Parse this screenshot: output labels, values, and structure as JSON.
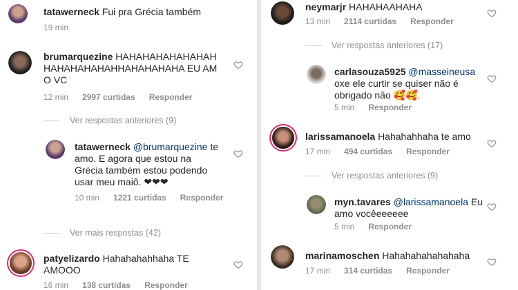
{
  "left": {
    "c1": {
      "user": "tatawerneck",
      "text": "Fui pra Grécia também",
      "time": "19 min"
    },
    "c2": {
      "user": "brumarquezine",
      "text": "HAHAHAHAHAHAHAH HAHAHAHAHAHHAHAHAHAHA EU AMO VC",
      "time": "12 min",
      "likes": "2997 curtidas",
      "reply": "Responder"
    },
    "view_prev": "Ver respostas anteriores (9)",
    "c3": {
      "user": "tatawerneck",
      "mention": "@brumarquezine",
      "text": "te amo. E agora que estou na Grécia também estou podendo usar meu maiô. ❤❤❤",
      "time": "10 min",
      "likes": "1221 curtidas",
      "reply": "Responder"
    },
    "view_more": "Ver mais respostas (42)",
    "c4": {
      "user": "patyelizardo",
      "text": "Hahahahahhaha TE AMOOO",
      "time": "16 min",
      "likes": "138 curtidas",
      "reply": "Responder"
    }
  },
  "right": {
    "c1": {
      "user": "neymarjr",
      "text": "HAHAHAAHAHA",
      "time": "13 min",
      "likes": "2114 curtidas",
      "reply": "Responder"
    },
    "view_prev1": "Ver respostas anteriores (17)",
    "c2": {
      "user": "carlasouza5925",
      "mention": "@masseineusa",
      "text": "oxe ele curtir se quiser não é obrigado não 🥰🥰.",
      "time": "5 min",
      "reply": "Responder"
    },
    "c3": {
      "user": "larissamanoela",
      "text": "Hahahahhaha te amo",
      "time": "17 min",
      "likes": "494 curtidas",
      "reply": "Responder"
    },
    "view_prev2": "Ver respostas anteriores (9)",
    "c4": {
      "user": "myn.tavares",
      "mention": "@larissamanoela",
      "text": "Eu amo vocêeeeeee",
      "time": "5 min",
      "reply": "Responder"
    },
    "c5": {
      "user": "marinamoschen",
      "text": "Hahahahahahahaha",
      "time": "17 min",
      "likes": "314 curtidas",
      "reply": "Responder"
    }
  },
  "icons": {
    "like": "heart-outline-icon"
  },
  "colors": {
    "ring": "#d62976",
    "meta": "#8e8e8e",
    "mention": "#003569"
  }
}
